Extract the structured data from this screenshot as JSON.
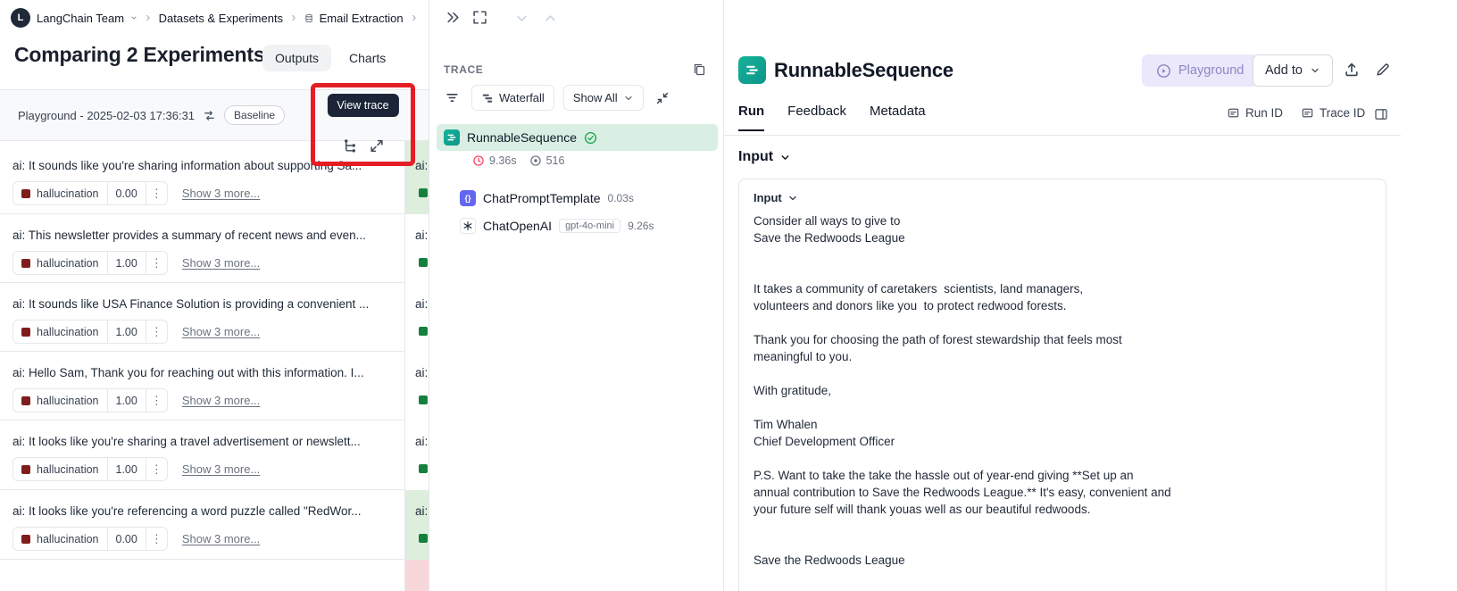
{
  "colors": {
    "annotation_red": "#e51e25",
    "tooltip_bg": "#1b2537",
    "trace_selected_green": "#d9efe3",
    "col2_match_green": "#ddeedd",
    "col2_mismatch_pink": "#f8d7db",
    "hallucination_icon_dark": "#7f1d1d",
    "hallucination_icon_green": "#15803d",
    "chain_icon_teal": "#0d9488",
    "prompt_icon_indigo": "#6366f1",
    "playground_button_bg": "#eae8fa"
  },
  "icons": {
    "kebab": "⋮",
    "logo_glyph": "L",
    "braces_glyph": "{}"
  },
  "breadcrumb": {
    "team_label": "LangChain Team",
    "datasets_label": "Datasets & Experiments",
    "dataset_name": "Email Extraction"
  },
  "comparison": {
    "title": "Comparing 2 Experiments",
    "outputs_tab": "Outputs",
    "charts_tab": "Charts",
    "experiment_name": "Playground - 2025-02-03 17:36:31",
    "baseline_label": "Baseline",
    "view_trace_tooltip": "View trace",
    "metric_label": "hallucination",
    "show_more_label": "Show 3 more...",
    "rows": [
      {
        "text": "ai: It sounds like you're sharing information about supporting Sa...",
        "score": "0.00",
        "col2_text": "ai:"
      },
      {
        "text": "ai: This newsletter provides a summary of recent news and even...",
        "score": "1.00",
        "col2_text": "ai:"
      },
      {
        "text": "ai: It sounds like USA Finance Solution is providing a convenient ...",
        "score": "1.00",
        "col2_text": "ai:"
      },
      {
        "text": "ai: Hello Sam, Thank you for reaching out with this information. I...",
        "score": "1.00",
        "col2_text": "ai:"
      },
      {
        "text": "ai: It looks like you're sharing a travel advertisement or newslett...",
        "score": "1.00",
        "col2_text": "ai:"
      },
      {
        "text": "ai: It looks like you're referencing a word puzzle called \"RedWor...",
        "score": "0.00",
        "col2_text": "ai:"
      }
    ]
  },
  "trace_panel": {
    "title": "TRACE",
    "waterfall_label": "Waterfall",
    "show_all_label": "Show All",
    "root_name": "RunnableSequence",
    "root_duration": "9.36s",
    "root_tokens": "516",
    "children": [
      {
        "name": "ChatPromptTemplate",
        "duration": "0.03s"
      },
      {
        "name": "ChatOpenAI",
        "model": "gpt-4o-mini",
        "duration": "9.26s"
      }
    ]
  },
  "detail": {
    "title": "RunnableSequence",
    "playground_label": "Playground",
    "add_to_label": "Add to",
    "tab_run": "Run",
    "tab_feedback": "Feedback",
    "tab_metadata": "Metadata",
    "run_id_label": "Run ID",
    "trace_id_label": "Trace ID",
    "input_heading": "Input",
    "input_selector_label": "Input",
    "input_text": "Consider all ways to give to\nSave the Redwoods League\n\n\nIt takes a community of caretakers  scientists, land managers,\nvolunteers and donors like you  to protect redwood forests.\n\nThank you for choosing the path of forest stewardship that feels most\nmeaningful to you.\n\nWith gratitude,\n\nTim Whalen\nChief Development Officer\n\nP.S. Want to take the take the hassle out of year-end giving **Set up an\nannual contribution to Save the Redwoods League.** It's easy, convenient and\nyour future self will thank youas well as our beautiful redwoods.\n\n\nSave the Redwoods League"
  }
}
